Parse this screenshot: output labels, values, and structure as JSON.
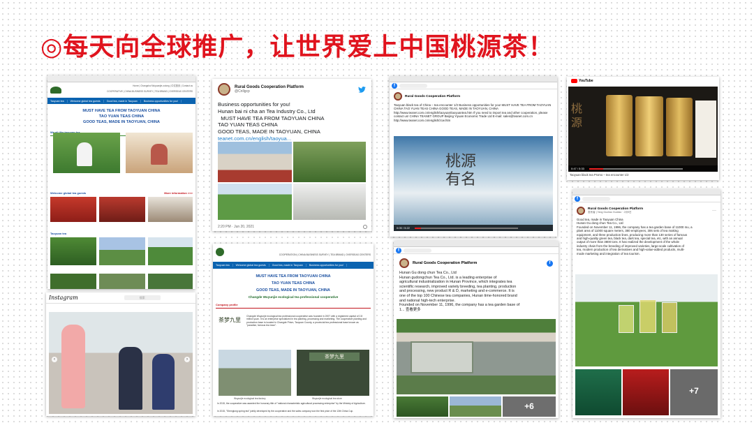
{
  "headline": "◎每天向全球推广，让世界爱上中国桃源茶！",
  "website": {
    "topbar_text": "Home | Changshui Wuyuanjie-oolong | 中文首页 | Contact us",
    "header_right": "COOPERATIVE | CHINA BUSINESS SURVEY | TEA BRAND | OVERSEAS CENTERS",
    "nav": [
      "Taoyuan tea",
      "Welcome global tea guests",
      "Good tea, made in Taoyuan",
      "Business opportunities for you!"
    ],
    "headlines": [
      "MUST HAVE TEA FROM TAOYUAN CHINA",
      "TAO YUAN TEAS CHINA",
      "GOOD TEAS, MADE IN TAOYUAN, CHINA"
    ],
    "section_all": "We all like taoyuan tea",
    "section_guests": "Welcome global tea guests",
    "more": "More information >>>",
    "section_tea": "Taoyuan tea"
  },
  "twitter": {
    "name": "Rural Goods Cooperation Platform",
    "handle": "@Cnllgcp",
    "body": [
      "Business opportunities for you!",
      "Hunan bai ni cha an Tea Industry Co., Ltd",
      "  MUST HAVE TEA FROM TAOYUAN CHINA",
      "TAO YUAN TEAS CHINA",
      "GOOD TEAS, MADE IN TAOYUAN, CHINA"
    ],
    "link": "teanet.com.cn/english/taoyua...",
    "timestamp": "2:20 PM · Jun 20, 2021"
  },
  "fb1": {
    "name": "Rural Goods Cooperation Platform",
    "text": "Taoyuan black tea of China – tea encounter 1/2 Business opportunities for you! MUST HAVE TEA FROM TAOYUAN CHINA TAO YUAN TEAS CHINA GOOD TEAS, MADE IN TAOYUAN, CHINA http://www.teanet.com.cn/english/taoyuan/taoyuantea.htm If you need to import tea and other cooperation, please contact us! CHINA TEANET GROUP Beijing Yiyuan Economic Trade Ltd E-mail: sales@teanet.com.cn http://www.teanet.com.cn/english/zcw.htm",
    "calligraphy": "桃源有名",
    "time": "0:05 / 5:22"
  },
  "youtube": {
    "brand": "YouTube",
    "caption": "Taoyuan black tea Promo – tea encounter 1/2",
    "calligraphy": "桃源",
    "time": "0:47 / 5:33"
  },
  "instagram": {
    "brand": "Instagram",
    "search": "搜索"
  },
  "website2": {
    "header_right": "COOPERATION | CHINA BUSINESS SURVEY | TEA BRAND | OVERSEAS CENTERS",
    "nav": [
      "Taoyuan tea",
      "Welcome global tea guests",
      "Good tea, made in Taoyuan",
      "Business opportunities for you!"
    ],
    "headlines": [
      "MUST HAVE TEA FROM TAOYUAN CHINA",
      "TAO YUAN TEAS CHINA",
      "GOOD TEAS, MADE IN TAOYUAN, CHINA"
    ],
    "subhead": "Changde Wuyunjie ecological tea professional cooperative",
    "section": "Company profile",
    "logo_text": "茶梦九里",
    "sign_text": "茶梦九里",
    "caption_left": "Wuyunjie ecological tea factory",
    "caption_right": "Wuyunjie ecological tea store",
    "para": "Changde Wuyunjie ecological tea professional cooperative was founded in 2007 with a registered capital of 2.8 million yuan. It is an enterprise specialized in tea planting, processing and marketing. The cooperative planting and production base is located in Changde Prism, Taoyuan County, a provincial tea professional base known as \"paradise, famous tea town\".",
    "para2": "In 2015, the cooperative was awarded the honorary title of \"national characteristic agricultural processing enterprise\" by the Ministry of Agriculture.",
    "para3": "In 2015, \"Shenglong spring tea\" jointly developed by the cooperative and the sales company won the first prize of the 13th China Cup."
  },
  "fb2": {
    "name": "Rural Goods Cooperation Platform",
    "lines": [
      "Hunan Gu dong chun Tea Co., Ltd",
      "Hunan gudongchun Tea Co., Ltd. is a leading enterprise of",
      "agricultural industrialization in Hunan Province, which integrates tea",
      "scientific research, improved variety breeding, tea planting, production",
      "and processing, new product R & D, marketing and e-commerce. It is",
      "one of the top 100 Chinese tea companies, Hunan time-honored brand",
      "and national high-tech enterprise.",
      "Founded on November 11, 1996, the company has a tea garden base of",
      "1...   查看更多"
    ],
    "more_count": "+6"
  },
  "fb3": {
    "name": "Rural Goods Cooperation Platform",
    "sub": "发布者 | Tang Guoliao Guoliao · 2月9日",
    "lines": [
      "Good tea, made in Taoyuan China",
      "Hunan Gu dong chun Tea Co., Ltd",
      "Founded on November 11, 1996, the company has a tea garden base of 11000 mu, a",
      "plant area of 11000 square meters, 380 employees, 306 sets of tea making",
      "equipment, and three production lines, producing more than 130 series of famous",
      "and high-quality green tea, black tea, dark tea, special tea, etc, with an annual",
      "output of more than 3800 tons. It has realized the development of the whole",
      "industry chain from the breeding of improved varieties, large-scale cultivation of",
      "tea, modern production of tea derivatives and high-value-added products, multi-",
      "mode marketing and integration of tea tourism."
    ],
    "more_count": "+7"
  }
}
